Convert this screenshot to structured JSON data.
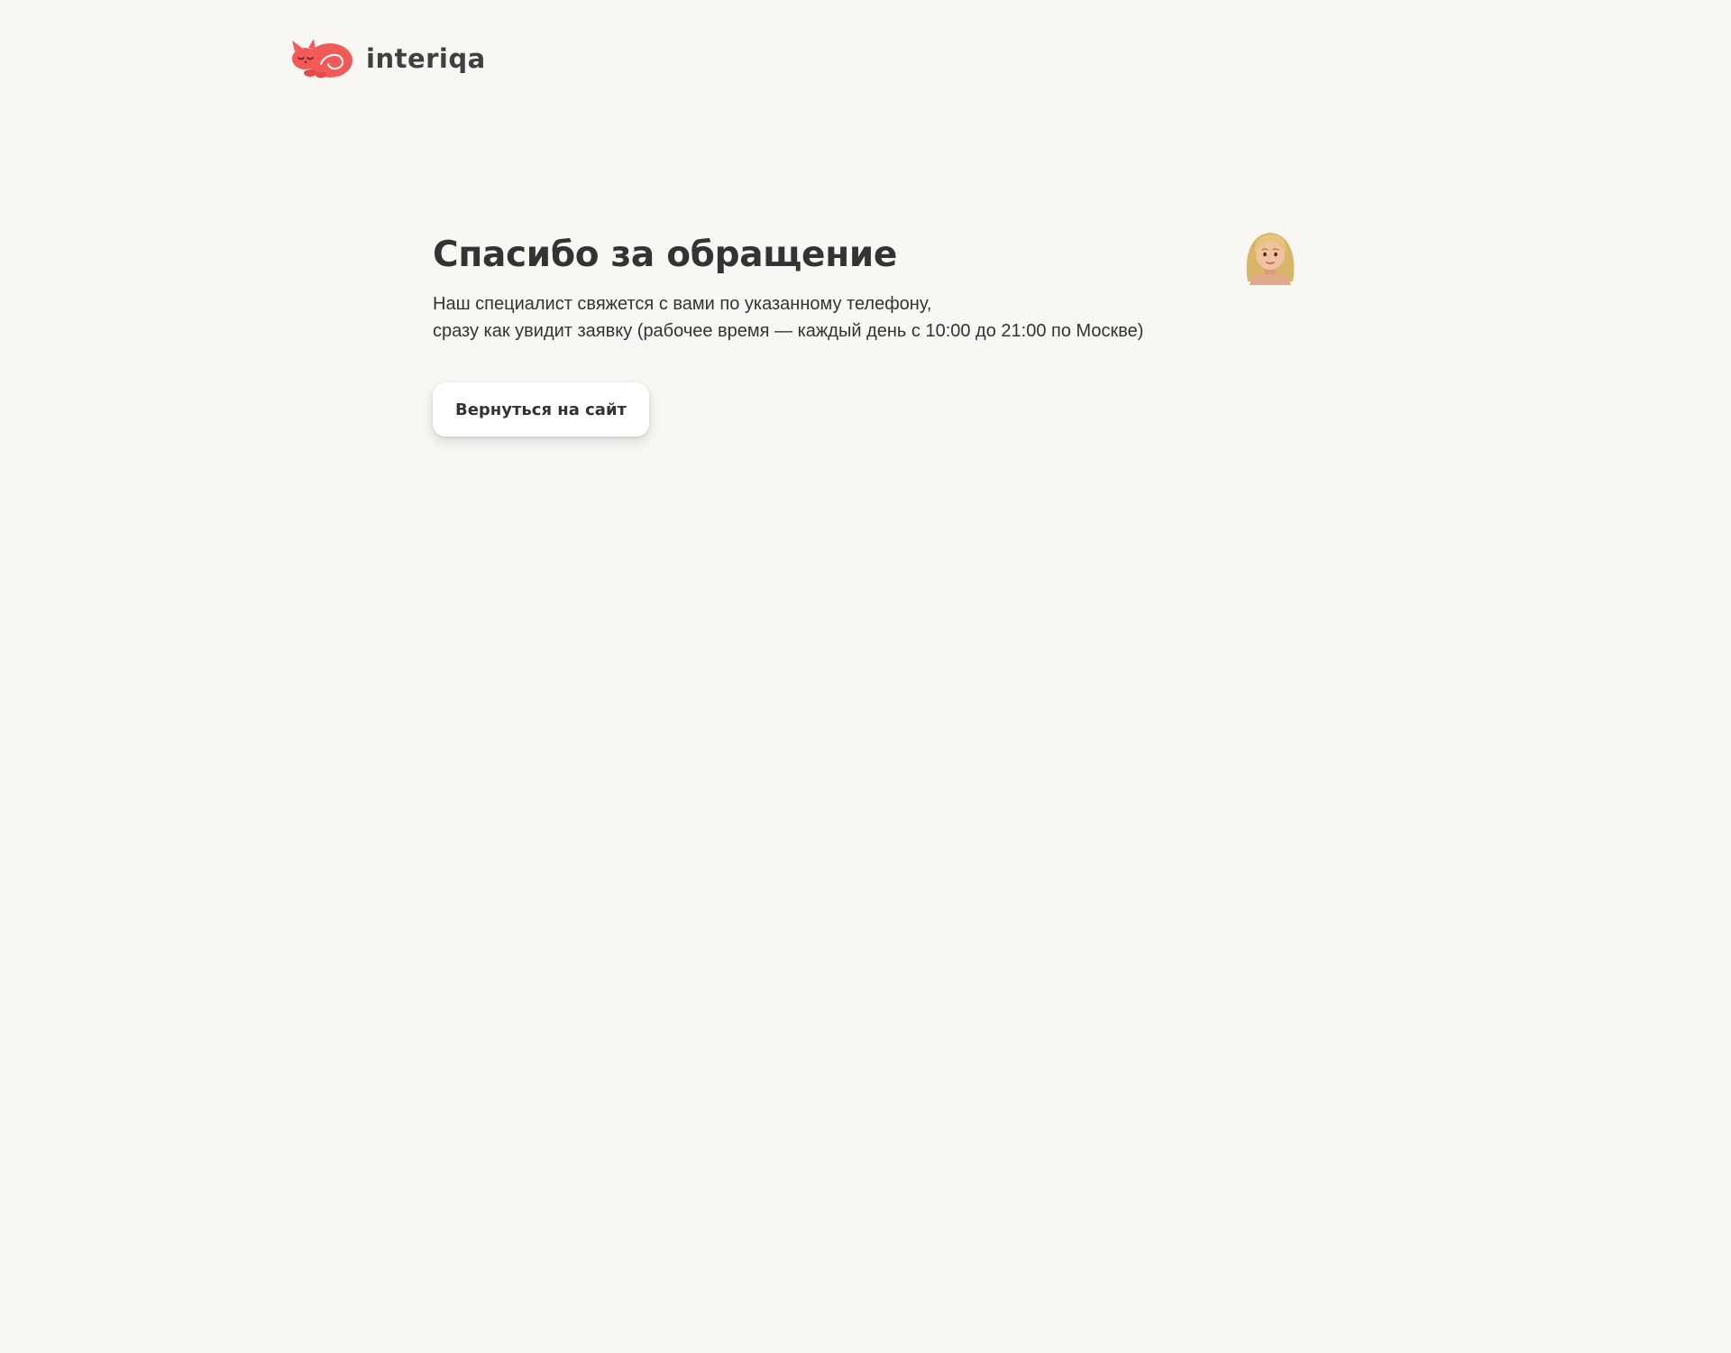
{
  "header": {
    "logo_text": "interiqa",
    "logo_icon": "sleeping-cat-logo-icon",
    "brand_color": "#f25a5a"
  },
  "main": {
    "title": "Спасибо за обращение",
    "text_line_1": "Наш специалист свяжется с вами по указанному телефону,",
    "text_line_2": "сразу как увидит заявку (рабочее время — каждый день с 10:00 до 21:00 по Москве)",
    "back_button_label": "Вернуться на сайт",
    "avatar_icon": "woman-emoji-icon"
  },
  "colors": {
    "background": "#f8f7f4",
    "text": "#333333",
    "button_bg": "#ffffff"
  }
}
